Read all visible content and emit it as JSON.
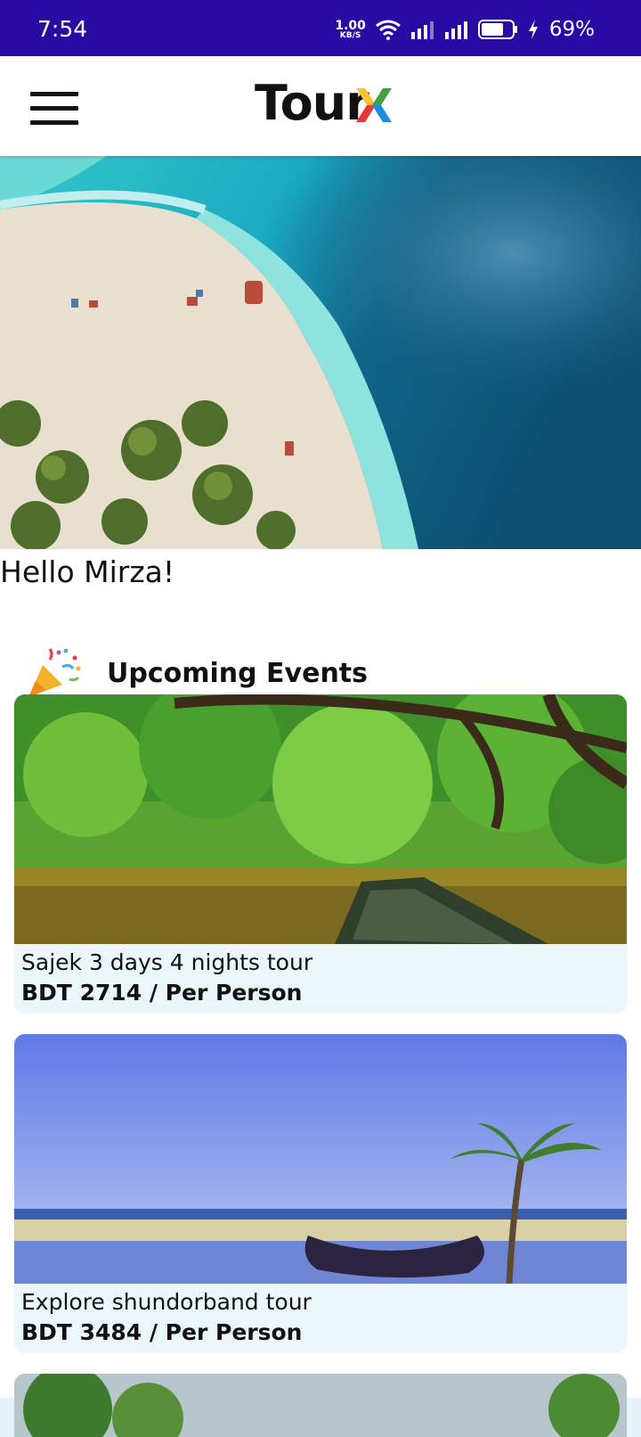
{
  "status_bar": {
    "time": "7:54",
    "net_speed_value": "1.00",
    "net_speed_unit": "KB/S",
    "battery": "69%"
  },
  "app_bar": {
    "brand_prefix": "Tour",
    "brand_suffix": "X",
    "menu_icon": "hamburger-menu-icon"
  },
  "greeting": "Hello Mirza!",
  "section": {
    "title": "Upcoming Events",
    "icon": "party-popper-icon"
  },
  "events": [
    {
      "name": "Sajek 3 days 4 nights tour",
      "price": "BDT 2714 / Per Person"
    },
    {
      "name": "Explore shundorband tour",
      "price": "BDT 3484 / Per Person"
    }
  ],
  "colors": {
    "status_bar": "#2a0aa4",
    "card_bg": "#eaf6fc",
    "brand_x_colors": [
      "#e53935",
      "#43a047",
      "#1e88e5",
      "#fbc02d"
    ]
  }
}
